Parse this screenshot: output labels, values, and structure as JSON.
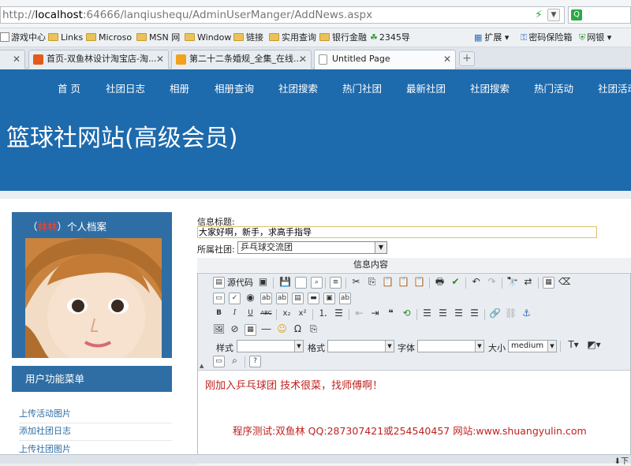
{
  "browser": {
    "url_prefix": "http://",
    "url_host": "localhost",
    "url_path": ":64666/lanqiushequ/AdminUserManger/AddNews.aspx",
    "go_icon": "lightning-icon",
    "search_icon": "search-engine-icon"
  },
  "favorites": {
    "items": [
      {
        "label": "游戏中心"
      },
      {
        "label": "Links"
      },
      {
        "label": "Microso"
      },
      {
        "label": "MSN 网"
      },
      {
        "label": "Window"
      },
      {
        "label": "链接"
      },
      {
        "label": "实用查询"
      },
      {
        "label": "银行金融"
      },
      {
        "label": "2345导"
      }
    ],
    "right": [
      {
        "label": "扩展"
      },
      {
        "label": "密码保险箱"
      },
      {
        "label": "网银"
      }
    ]
  },
  "tabs": [
    {
      "label": "首页-双鱼林设计淘宝店-淘...",
      "active": false
    },
    {
      "label": "第二十二条婚规_全集_在线...",
      "active": false
    },
    {
      "label": "Untitled Page",
      "active": true
    }
  ],
  "site": {
    "nav": [
      "首 页",
      "社团日志",
      "相册",
      "相册查询",
      "社团搜索",
      "热门社团",
      "最新社团",
      "社团搜索",
      "热门活动",
      "社团活动"
    ],
    "title": "篮球社网站(高级会员)"
  },
  "sidebar": {
    "profile_open": "（",
    "profile_name": "林林",
    "profile_close": "）个人档案",
    "menu_title": "用户功能菜单",
    "links": [
      "上传活动图片",
      "添加社团日志",
      "上传社团图片"
    ]
  },
  "form": {
    "title_label": "信息标题:",
    "title_value": "大家好啊，新手，求高手指导",
    "club_label": "所属社团:",
    "club_value": "乒乓球交流团",
    "content_label": "信息内容"
  },
  "editor": {
    "source_label": "源代码",
    "style_label": "样式",
    "format_label": "格式",
    "font_label": "字体",
    "size_label": "大小",
    "size_value": "medium",
    "body_line1": "刚加入乒乓球团 技术很菜，找师傅啊！",
    "body_line2": "程序测试:双鱼林 QQ:287307421或254540457 网站:www.shuangyulin.com"
  },
  "colors": {
    "header_blue": "#1d6aad",
    "panel_blue": "#2f6ea4",
    "red_text": "#c0211f"
  }
}
